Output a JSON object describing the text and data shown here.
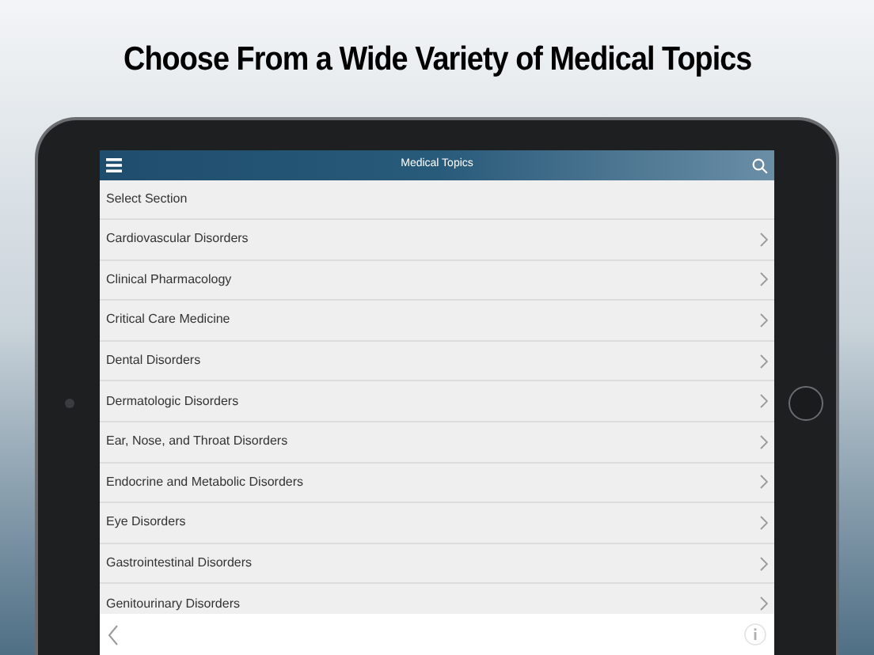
{
  "headline": "Choose From a Wide Variety of Medical Topics",
  "nav_bar": {
    "title": "Medical Topics"
  },
  "section_header": "Select Section",
  "items": [
    {
      "label": "Cardiovascular Disorders"
    },
    {
      "label": "Clinical Pharmacology"
    },
    {
      "label": "Critical Care Medicine"
    },
    {
      "label": "Dental Disorders"
    },
    {
      "label": "Dermatologic Disorders"
    },
    {
      "label": "Ear, Nose, and Throat Disorders"
    },
    {
      "label": "Endocrine and Metabolic Disorders"
    },
    {
      "label": "Eye Disorders"
    },
    {
      "label": "Gastrointestinal Disorders"
    },
    {
      "label": "Genitourinary Disorders"
    }
  ]
}
